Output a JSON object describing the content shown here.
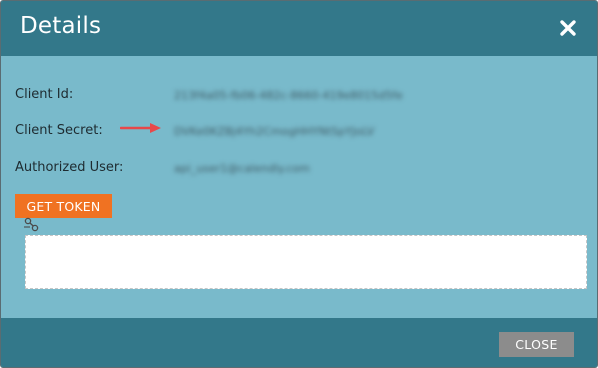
{
  "dialog": {
    "title": "Details",
    "close_icon": "close-x-icon"
  },
  "fields": [
    {
      "label": "Client Id:",
      "value": "213f4a05-fb06-482c-8660-419e8015d5fe"
    },
    {
      "label": "Client Secret:",
      "value": "DVKe0KZBj4Yh2CmogHHYNtSpYJoLV"
    },
    {
      "label": "Authorized User:",
      "value": "api_user1@calendly.com"
    }
  ],
  "buttons": {
    "get_token": "GET TOKEN",
    "close": "CLOSE"
  },
  "token_box": {
    "value": ""
  },
  "colors": {
    "header": "#33788a",
    "body": "#79bacb",
    "accent_button": "#f07222",
    "close_button": "#8c8c8c",
    "arrow": "#e8484a"
  }
}
